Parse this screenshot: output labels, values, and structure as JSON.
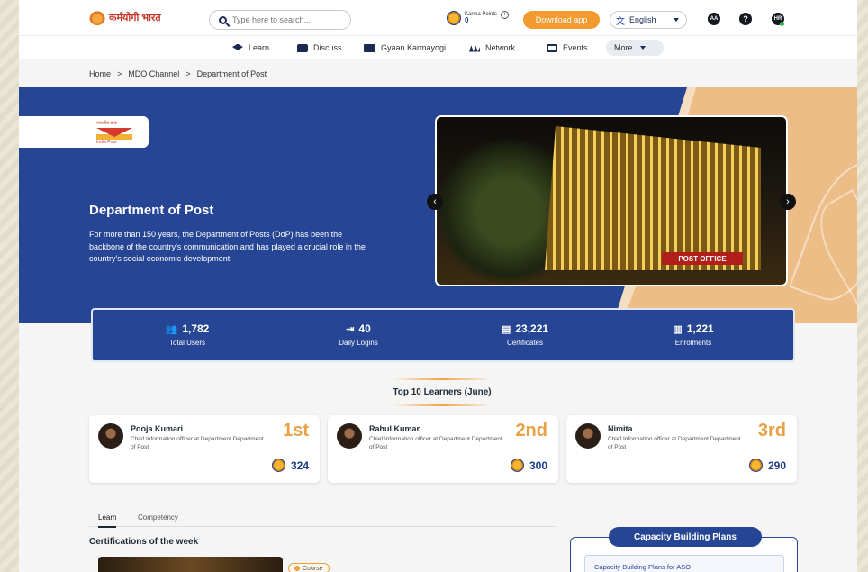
{
  "header": {
    "logo_text": "कर्मयोगी भारत",
    "search_placeholder": "Type here to search...",
    "karma_label": "Karma Points",
    "karma_value": "0",
    "download_label": "Download app",
    "language": "English",
    "aa_label": "AA",
    "help_label": "?",
    "avatar_initials": "HR"
  },
  "nav": {
    "items": [
      {
        "label": "Learn",
        "icon": "graduation-cap-icon"
      },
      {
        "label": "Discuss",
        "icon": "chat-icon"
      },
      {
        "label": "Gyaan Karmayogi",
        "icon": "book-icon"
      },
      {
        "label": "Network",
        "icon": "network-icon"
      },
      {
        "label": "Events",
        "icon": "calendar-icon"
      }
    ],
    "more_label": "More"
  },
  "breadcrumb": {
    "home": "Home",
    "sep": ">",
    "channel": "MDO Channel",
    "current": "Department of Post"
  },
  "hero": {
    "title": "Department of Post",
    "description": "For more than 150 years, the Department of Posts (DoP) has been the backbone of the country's communication and has played a crucial role in the country's social economic development.",
    "logo_text_top": "भारतीय डाक",
    "logo_text_bottom": "India Post",
    "photo_sign": "POST OFFICE",
    "prev": "‹",
    "next": "›"
  },
  "stats": [
    {
      "value": "1,782",
      "label": "Total Users",
      "icon": "users-icon",
      "glyph": "👥"
    },
    {
      "value": "40",
      "label": "Daily Logins",
      "icon": "login-icon",
      "glyph": "⇥"
    },
    {
      "value": "23,221",
      "label": "Certificates",
      "icon": "certificate-icon",
      "glyph": "▤"
    },
    {
      "value": "1,221",
      "label": "Enrolments",
      "icon": "book-icon",
      "glyph": "▥"
    }
  ],
  "learners": {
    "title": "Top 10 Learners (June)",
    "cards": [
      {
        "name": "Pooja Kumari",
        "role": "Chief Information officer at Department Department of Post",
        "rank": "1st",
        "points": "324"
      },
      {
        "name": "Rahul Kumar",
        "role": "Chief Information officer at Department Department of Post",
        "rank": "2nd",
        "points": "300"
      },
      {
        "name": "Nimita",
        "role": "Chief Information officer at Department Department of Post",
        "rank": "3rd",
        "points": "290"
      }
    ]
  },
  "tabs": {
    "learn": "Learn",
    "competency": "Competency"
  },
  "certifications": {
    "title": "Certifications of the week",
    "tag": "Course"
  },
  "capacity": {
    "title": "Capacity Building Plans",
    "item": "Capacity Building Plans for ASO"
  }
}
